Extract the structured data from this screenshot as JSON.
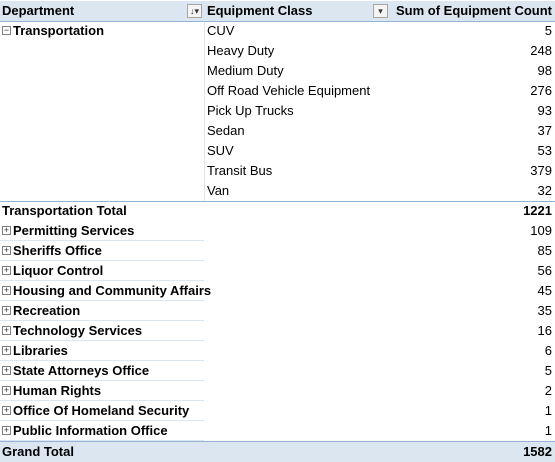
{
  "header": {
    "department": "Department",
    "equipment_class": "Equipment Class",
    "sum": "Sum of Equipment Count",
    "sort_icon": "sort-filter-icon",
    "filter_icon": "filter-dropdown-icon"
  },
  "transportation": {
    "name": "Transportation",
    "expander": "−",
    "classes": [
      {
        "label": "CUV",
        "value": "5"
      },
      {
        "label": "Heavy Duty",
        "value": "248"
      },
      {
        "label": "Medium Duty",
        "value": "98"
      },
      {
        "label": "Off Road Vehicle Equipment",
        "value": "276"
      },
      {
        "label": "Pick Up Trucks",
        "value": "93"
      },
      {
        "label": "Sedan",
        "value": "37"
      },
      {
        "label": "SUV",
        "value": "53"
      },
      {
        "label": "Transit Bus",
        "value": "379"
      },
      {
        "label": "Van",
        "value": "32"
      }
    ],
    "total_label": "Transportation Total",
    "total_value": "1221"
  },
  "departments": [
    {
      "label": "Permitting Services",
      "value": "109",
      "expander": "+"
    },
    {
      "label": "Sheriffs Office",
      "value": "85",
      "expander": "+"
    },
    {
      "label": "Liquor Control",
      "value": "56",
      "expander": "+"
    },
    {
      "label": "Housing and Community Affairs",
      "value": "45",
      "expander": "+"
    },
    {
      "label": "Recreation",
      "value": "35",
      "expander": "+"
    },
    {
      "label": "Technology Services",
      "value": "16",
      "expander": "+"
    },
    {
      "label": "Libraries",
      "value": "6",
      "expander": "+"
    },
    {
      "label": "State Attorneys Office",
      "value": "5",
      "expander": "+"
    },
    {
      "label": "Human Rights",
      "value": "2",
      "expander": "+"
    },
    {
      "label": "Office Of Homeland Security",
      "value": "1",
      "expander": "+"
    },
    {
      "label": "Public Information Office",
      "value": "1",
      "expander": "+"
    }
  ],
  "grand_total": {
    "label": "Grand Total",
    "value": "1582"
  }
}
